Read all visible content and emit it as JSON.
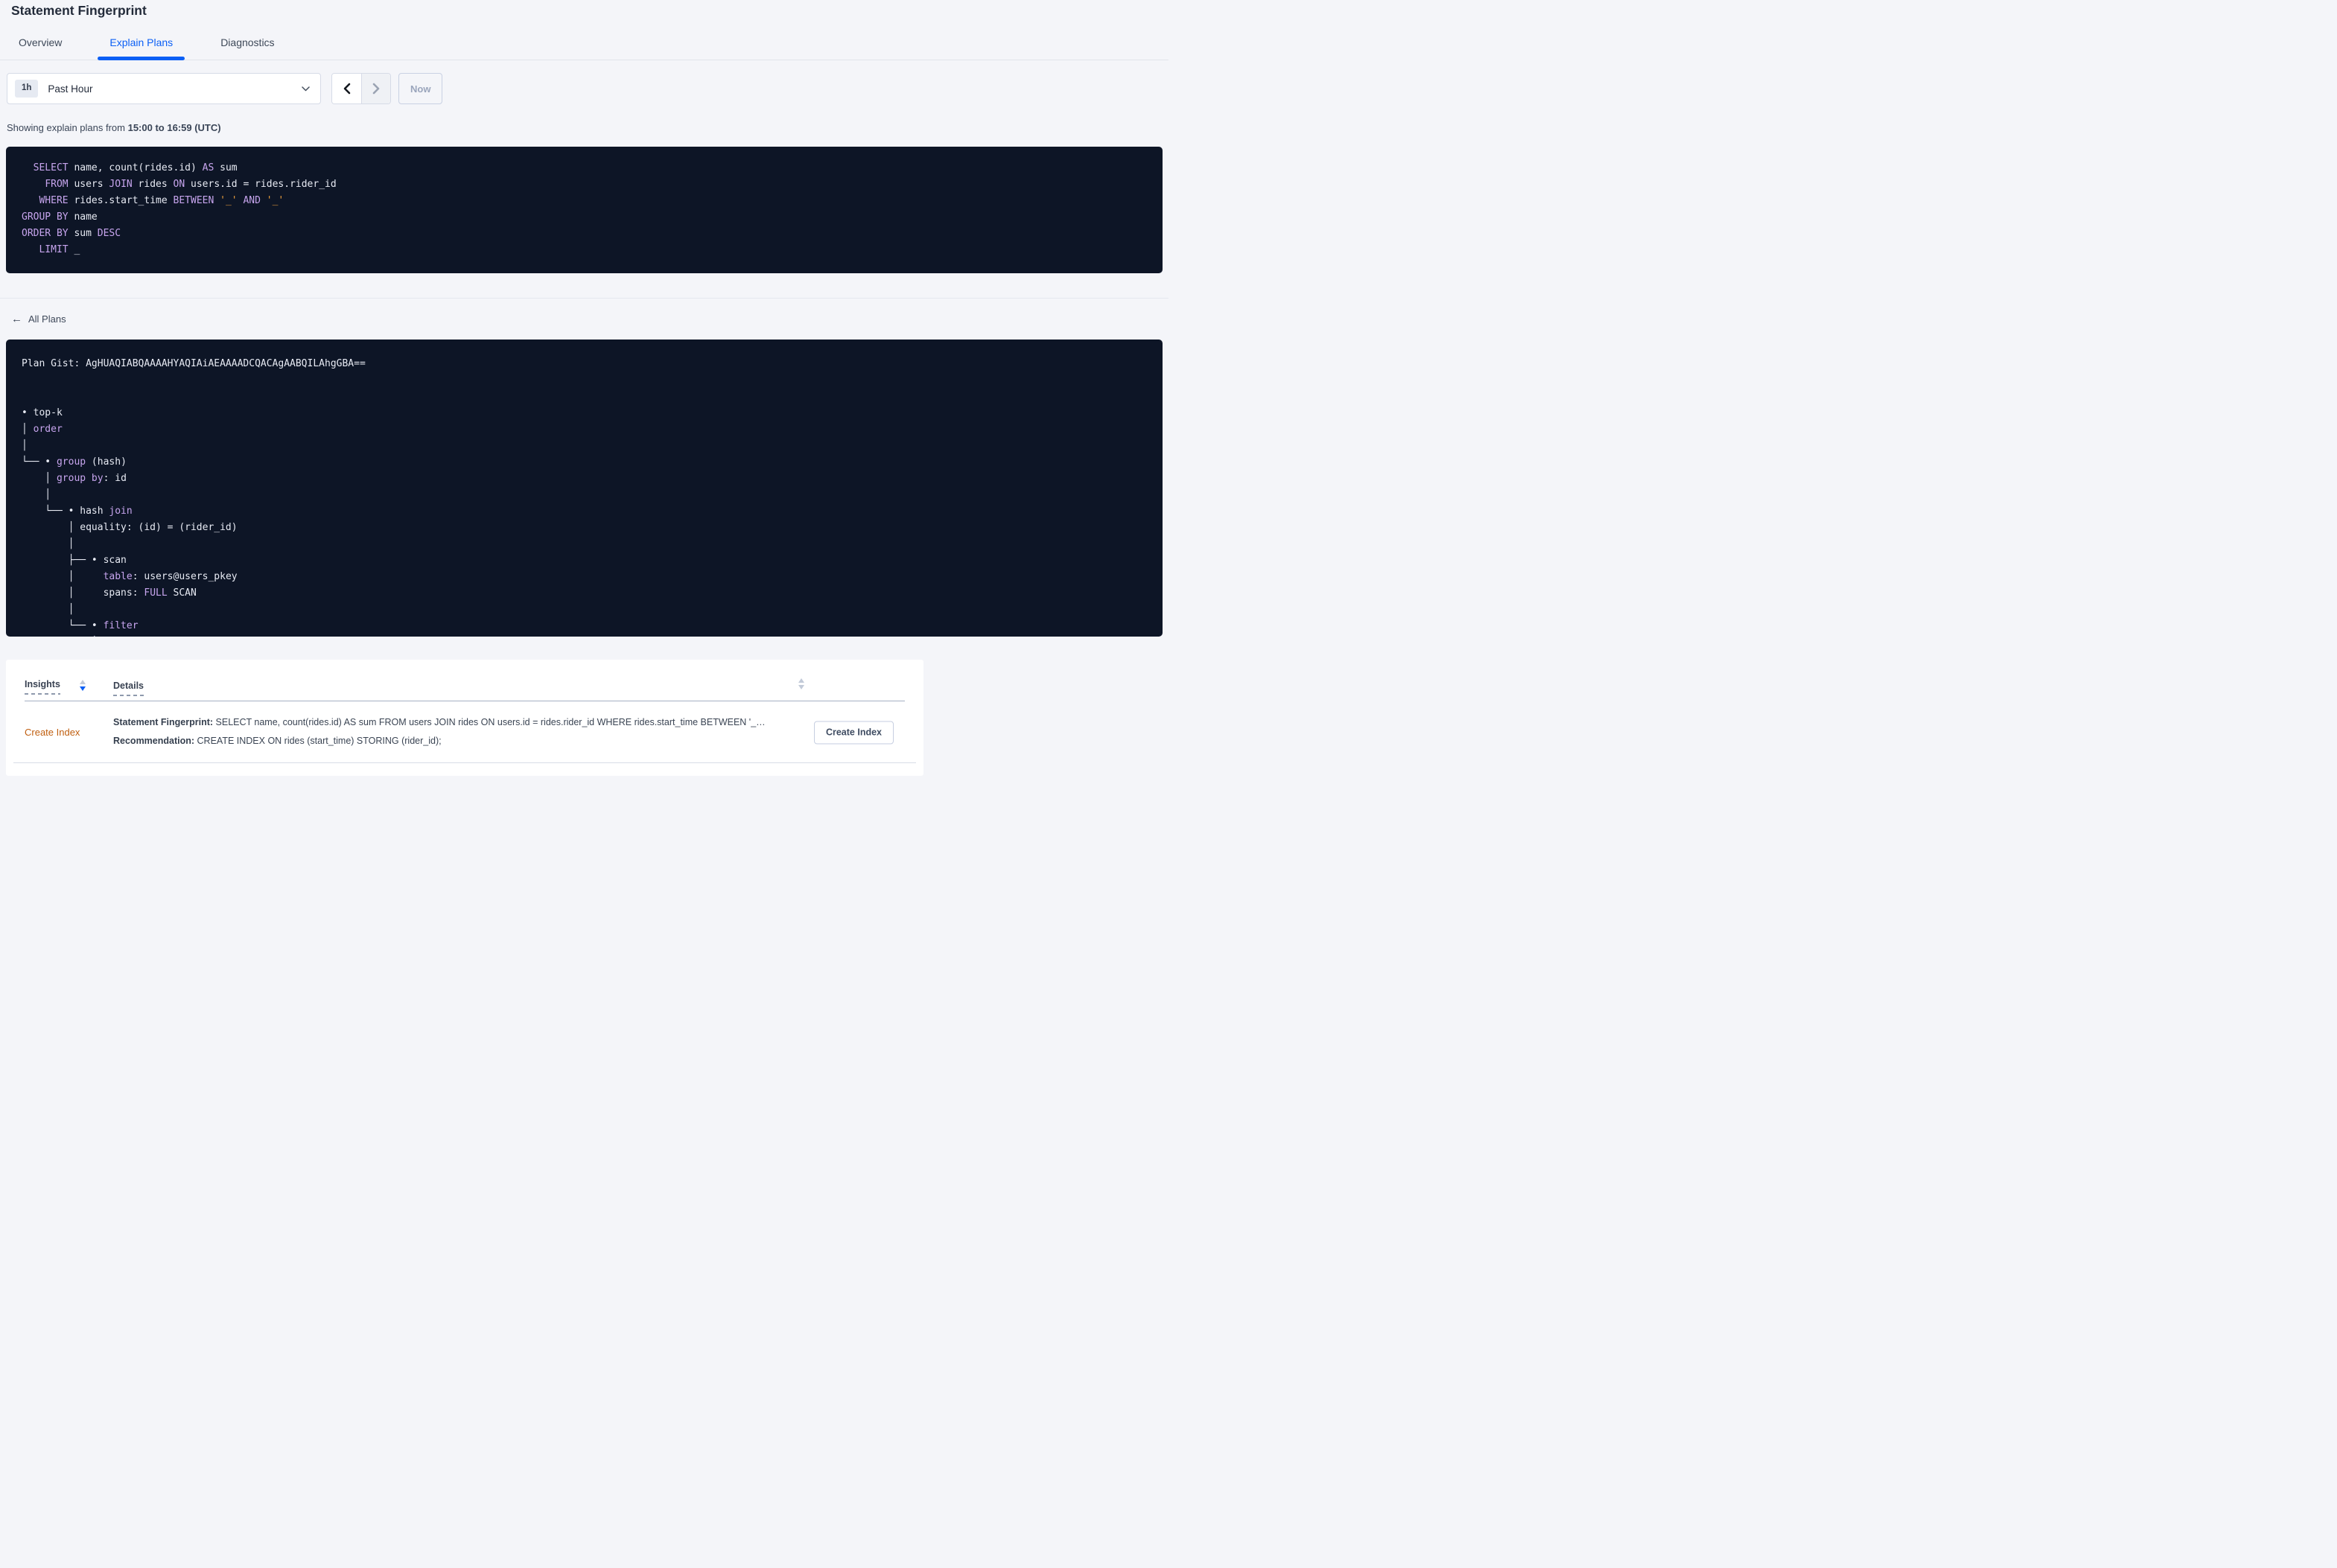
{
  "page": {
    "title": "Statement Fingerprint"
  },
  "tabs": [
    {
      "label": "Overview",
      "active": false
    },
    {
      "label": "Explain Plans",
      "active": true
    },
    {
      "label": "Diagnostics",
      "active": false
    }
  ],
  "time_controls": {
    "range_badge": "1h",
    "range_label": "Past Hour",
    "now_label": "Now",
    "prev_icon": "chevron-left",
    "next_icon": "chevron-right"
  },
  "showing": {
    "prefix": "Showing explain plans from ",
    "range": "15:00 to 16:59 (UTC)"
  },
  "back_link": {
    "arrow": "←",
    "label": "All Plans"
  },
  "colors": {
    "accent_blue": "#0b5ff5",
    "code_background": "#0d1526",
    "code_keyword": "#c7a5ee",
    "code_string": "#f0a13b",
    "insight_orange": "#c05f10"
  },
  "sql_block": {
    "lines": [
      [
        {
          "t": "  "
        },
        {
          "t": "SELECT",
          "c": "kw"
        },
        {
          "t": " name, count(rides.id) "
        },
        {
          "t": "AS",
          "c": "kw"
        },
        {
          "t": " sum"
        }
      ],
      [
        {
          "t": "    "
        },
        {
          "t": "FROM",
          "c": "kw"
        },
        {
          "t": " users "
        },
        {
          "t": "JOIN",
          "c": "kw"
        },
        {
          "t": " rides "
        },
        {
          "t": "ON",
          "c": "kw"
        },
        {
          "t": " users.id = rides.rider_id"
        }
      ],
      [
        {
          "t": "   "
        },
        {
          "t": "WHERE",
          "c": "kw"
        },
        {
          "t": " rides.start_time "
        },
        {
          "t": "BETWEEN",
          "c": "kw"
        },
        {
          "t": " "
        },
        {
          "t": "'_'",
          "c": "str"
        },
        {
          "t": " "
        },
        {
          "t": "AND",
          "c": "kw"
        },
        {
          "t": " "
        },
        {
          "t": "'_'",
          "c": "str"
        }
      ],
      [
        {
          "t": "GROUP BY",
          "c": "kw"
        },
        {
          "t": " name"
        }
      ],
      [
        {
          "t": "ORDER BY",
          "c": "kw"
        },
        {
          "t": " sum "
        },
        {
          "t": "DESC",
          "c": "kw"
        }
      ],
      [
        {
          "t": "   "
        },
        {
          "t": "LIMIT",
          "c": "kw"
        },
        {
          "t": " _"
        }
      ]
    ]
  },
  "plan_block": {
    "lines": [
      [
        {
          "t": "Plan Gist: AgHUAQIABQAAAAHYAQIAiAEAAAADCQACAgAABQILAhgGBA=="
        }
      ],
      [],
      [],
      [
        {
          "t": "• top-k"
        }
      ],
      [
        {
          "t": "│ "
        },
        {
          "t": "order",
          "c": "kw"
        }
      ],
      [
        {
          "t": "│"
        }
      ],
      [
        {
          "t": "└── • "
        },
        {
          "t": "group",
          "c": "kw"
        },
        {
          "t": " (hash)"
        }
      ],
      [
        {
          "t": "    │ "
        },
        {
          "t": "group by",
          "c": "kw"
        },
        {
          "t": ": id"
        }
      ],
      [
        {
          "t": "    │"
        }
      ],
      [
        {
          "t": "    └── • hash "
        },
        {
          "t": "join",
          "c": "kw"
        }
      ],
      [
        {
          "t": "        │ equality: (id) = (rider_id)"
        }
      ],
      [
        {
          "t": "        │"
        }
      ],
      [
        {
          "t": "        ├── • scan"
        }
      ],
      [
        {
          "t": "        │     "
        },
        {
          "t": "table",
          "c": "kw"
        },
        {
          "t": ": users@users_pkey"
        }
      ],
      [
        {
          "t": "        │     spans: "
        },
        {
          "t": "FULL",
          "c": "kw"
        },
        {
          "t": " SCAN"
        }
      ],
      [
        {
          "t": "        │"
        }
      ],
      [
        {
          "t": "        └── • "
        },
        {
          "t": "filter",
          "c": "kw"
        }
      ],
      [
        {
          "t": "            │"
        }
      ]
    ]
  },
  "insights_table": {
    "columns": [
      {
        "label": "Insights",
        "sort": "desc"
      },
      {
        "label": "Details",
        "sort": "none"
      }
    ],
    "row": {
      "insight": "Create Index",
      "line1_label": "Statement Fingerprint:",
      "line1_text": " SELECT name, count(rides.id) AS sum FROM users JOIN rides ON users.id = rides.rider_id WHERE rides.start_time BETWEEN '_…",
      "line2_label": "Recommendation:",
      "line2_text": " CREATE INDEX ON rides (start_time) STORING (rider_id);",
      "action_label": "Create Index"
    }
  }
}
